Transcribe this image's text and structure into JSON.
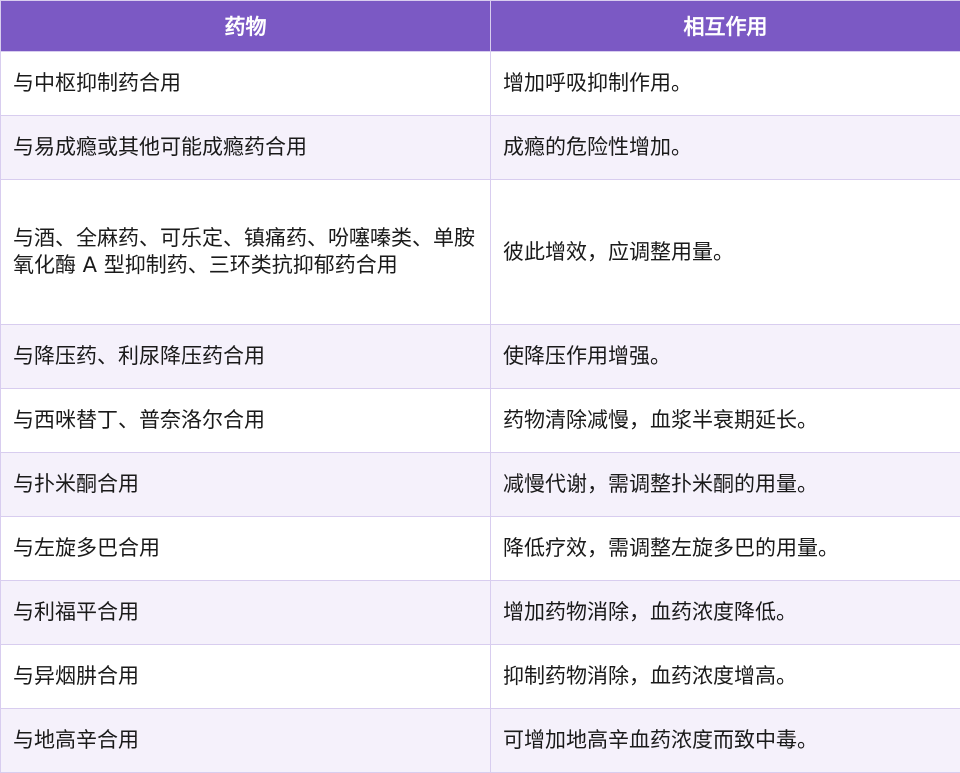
{
  "table": {
    "headers": [
      "药物",
      "相互作用"
    ],
    "rows": [
      [
        "与中枢抑制药合用",
        "增加呼吸抑制作用。"
      ],
      [
        "与易成瘾或其他可能成瘾药合用",
        "成瘾的危险性增加。"
      ],
      [
        "与酒、全麻药、可乐定、镇痛药、吩噻嗪类、单胺氧化酶 A 型抑制药、三环类抗抑郁药合用",
        "彼此增效，应调整用量。"
      ],
      [
        "与降压药、利尿降压药合用",
        "使降压作用增强。"
      ],
      [
        "与西咪替丁、普奈洛尔合用",
        "药物清除减慢，血浆半衰期延长。"
      ],
      [
        "与扑米酮合用",
        "减慢代谢，需调整扑米酮的用量。"
      ],
      [
        "与左旋多巴合用",
        "降低疗效，需调整左旋多巴的用量。"
      ],
      [
        "与利福平合用",
        "增加药物消除，血药浓度降低。"
      ],
      [
        "与异烟肼合用",
        "抑制药物消除，血药浓度增高。"
      ],
      [
        "与地高辛合用",
        "可增加地高辛血药浓度而致中毒。"
      ]
    ]
  }
}
